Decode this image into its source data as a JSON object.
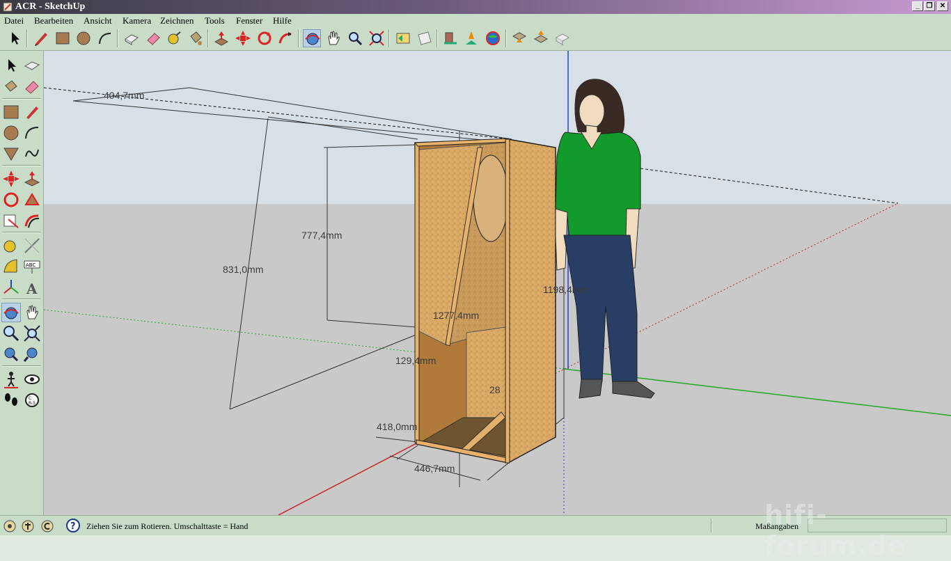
{
  "window": {
    "title": "ACR - SketchUp",
    "buttons": [
      "_",
      "❐",
      "✕"
    ]
  },
  "menu": [
    "Datei",
    "Bearbeiten",
    "Ansicht",
    "Kamera",
    "Zeichnen",
    "Tools",
    "Fenster",
    "Hilfe"
  ],
  "toolbar": {
    "tools": [
      "select",
      "pencil",
      "rectangle",
      "circle",
      "arc",
      "make-component",
      "eraser",
      "tape-measure",
      "paint-bucket",
      "push-pull",
      "move",
      "rotate",
      "follow-me",
      "orbit",
      "pan",
      "zoom",
      "zoom-extents",
      "previous-view",
      "next-view",
      "get-models",
      "share-model",
      "google-earth",
      "export",
      "import",
      "share-component"
    ],
    "active": "orbit"
  },
  "left_toolbar": {
    "active": [
      "orbit"
    ]
  },
  "dimensions": {
    "top_width": "404,7mm",
    "inner_height": "777,4mm",
    "diagonal": "831,0mm",
    "total_height": "1198,4mm",
    "port_length": "1277,4mm",
    "port_width": "129,4mm",
    "small": "28",
    "bottom_inner": "418,0mm",
    "bottom_outer": "446,7mm"
  },
  "colors": {
    "chrome": "#c8dcc8",
    "sky": "#d6e0e6",
    "ground": "#c9c9c9",
    "wood": "#d9a865",
    "axis_red": "#cc2222",
    "axis_green": "#22aa22",
    "axis_blue": "#2244cc"
  },
  "status": {
    "hint": "Ziehen Sie zum Rotieren.  Umschalttaste = Hand",
    "vcb_label": "Maßangaben",
    "vcb_value": ""
  },
  "watermark": "hifi-forum.de"
}
